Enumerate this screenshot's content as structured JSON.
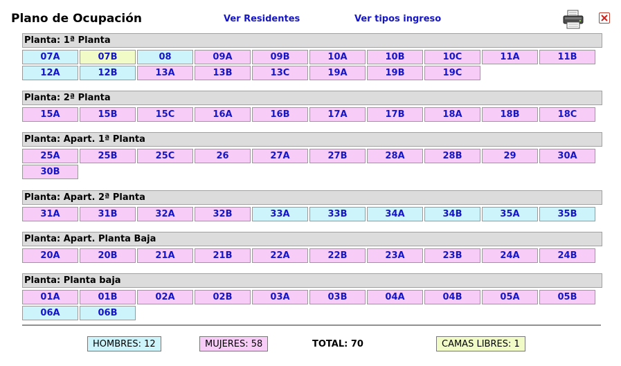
{
  "header": {
    "title": "Plano de Ocupación",
    "link_residents": "Ver Residentes",
    "link_types": "Ver tipos ingreso",
    "print_icon": "printer-icon",
    "close_icon": "close-icon"
  },
  "colors": {
    "hombre": "#cdf3fb",
    "mujer": "#f7cdf8",
    "libre": "#f1fbc8",
    "link": "#1515c8",
    "section_header": "#dcdcdc"
  },
  "sections": [
    {
      "label": "Planta: 1ª Planta",
      "rooms": [
        {
          "code": "07A",
          "status": "H"
        },
        {
          "code": "07B",
          "status": "L"
        },
        {
          "code": "08",
          "status": "H"
        },
        {
          "code": "09A",
          "status": "M"
        },
        {
          "code": "09B",
          "status": "M"
        },
        {
          "code": "10A",
          "status": "M"
        },
        {
          "code": "10B",
          "status": "M"
        },
        {
          "code": "10C",
          "status": "M"
        },
        {
          "code": "11A",
          "status": "M"
        },
        {
          "code": "11B",
          "status": "M"
        },
        {
          "code": "12A",
          "status": "H"
        },
        {
          "code": "12B",
          "status": "H"
        },
        {
          "code": "13A",
          "status": "M"
        },
        {
          "code": "13B",
          "status": "M"
        },
        {
          "code": "13C",
          "status": "M"
        },
        {
          "code": "19A",
          "status": "M"
        },
        {
          "code": "19B",
          "status": "M"
        },
        {
          "code": "19C",
          "status": "M"
        }
      ]
    },
    {
      "label": "Planta: 2ª Planta",
      "rooms": [
        {
          "code": "15A",
          "status": "M"
        },
        {
          "code": "15B",
          "status": "M"
        },
        {
          "code": "15C",
          "status": "M"
        },
        {
          "code": "16A",
          "status": "M"
        },
        {
          "code": "16B",
          "status": "M"
        },
        {
          "code": "17A",
          "status": "M"
        },
        {
          "code": "17B",
          "status": "M"
        },
        {
          "code": "18A",
          "status": "M"
        },
        {
          "code": "18B",
          "status": "M"
        },
        {
          "code": "18C",
          "status": "M"
        }
      ]
    },
    {
      "label": "Planta: Apart. 1ª Planta",
      "rooms": [
        {
          "code": "25A",
          "status": "M"
        },
        {
          "code": "25B",
          "status": "M"
        },
        {
          "code": "25C",
          "status": "M"
        },
        {
          "code": "26",
          "status": "M"
        },
        {
          "code": "27A",
          "status": "M"
        },
        {
          "code": "27B",
          "status": "M"
        },
        {
          "code": "28A",
          "status": "M"
        },
        {
          "code": "28B",
          "status": "M"
        },
        {
          "code": "29",
          "status": "M"
        },
        {
          "code": "30A",
          "status": "M"
        },
        {
          "code": "30B",
          "status": "M"
        }
      ]
    },
    {
      "label": "Planta: Apart. 2ª Planta",
      "rooms": [
        {
          "code": "31A",
          "status": "M"
        },
        {
          "code": "31B",
          "status": "M"
        },
        {
          "code": "32A",
          "status": "M"
        },
        {
          "code": "32B",
          "status": "M"
        },
        {
          "code": "33A",
          "status": "H"
        },
        {
          "code": "33B",
          "status": "H"
        },
        {
          "code": "34A",
          "status": "H"
        },
        {
          "code": "34B",
          "status": "H"
        },
        {
          "code": "35A",
          "status": "H"
        },
        {
          "code": "35B",
          "status": "H"
        }
      ]
    },
    {
      "label": "Planta: Apart. Planta Baja",
      "rooms": [
        {
          "code": "20A",
          "status": "M"
        },
        {
          "code": "20B",
          "status": "M"
        },
        {
          "code": "21A",
          "status": "M"
        },
        {
          "code": "21B",
          "status": "M"
        },
        {
          "code": "22A",
          "status": "M"
        },
        {
          "code": "22B",
          "status": "M"
        },
        {
          "code": "23A",
          "status": "M"
        },
        {
          "code": "23B",
          "status": "M"
        },
        {
          "code": "24A",
          "status": "M"
        },
        {
          "code": "24B",
          "status": "M"
        }
      ]
    },
    {
      "label": "Planta: Planta baja",
      "rooms": [
        {
          "code": "01A",
          "status": "M"
        },
        {
          "code": "01B",
          "status": "M"
        },
        {
          "code": "02A",
          "status": "M"
        },
        {
          "code": "02B",
          "status": "M"
        },
        {
          "code": "03A",
          "status": "M"
        },
        {
          "code": "03B",
          "status": "M"
        },
        {
          "code": "04A",
          "status": "M"
        },
        {
          "code": "04B",
          "status": "M"
        },
        {
          "code": "05A",
          "status": "M"
        },
        {
          "code": "05B",
          "status": "M"
        },
        {
          "code": "06A",
          "status": "H"
        },
        {
          "code": "06B",
          "status": "H"
        }
      ]
    }
  ],
  "footer": {
    "hombres": "HOMBRES: 12",
    "mujeres": "MUJERES: 58",
    "total": "TOTAL: 70",
    "camas_libres": "CAMAS LIBRES: 1"
  }
}
